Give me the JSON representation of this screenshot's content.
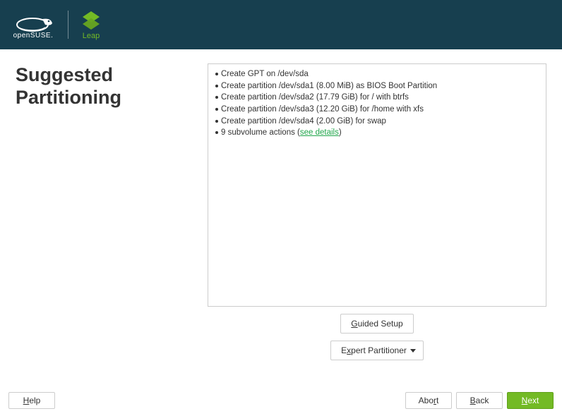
{
  "header": {
    "suse_text": "openSUSE.",
    "leap_text": "Leap"
  },
  "page": {
    "title": "Suggested Partitioning"
  },
  "actions": {
    "items": [
      {
        "text": "Create GPT on /dev/sda"
      },
      {
        "text": "Create partition /dev/sda1 (8.00 MiB) as BIOS Boot Partition"
      },
      {
        "text": "Create partition /dev/sda2 (17.79 GiB) for / with btrfs"
      },
      {
        "text": "Create partition /dev/sda3 (12.20 GiB) for /home with xfs"
      },
      {
        "text": "Create partition /dev/sda4 (2.00 GiB) for swap"
      }
    ],
    "subvolume_prefix": "9 subvolume actions (",
    "subvolume_link": "see details",
    "subvolume_suffix": ")"
  },
  "buttons": {
    "guided_m": "G",
    "guided_rest": "uided Setup",
    "expert_pre": "E",
    "expert_m": "x",
    "expert_rest": "pert Partitioner",
    "help_m": "H",
    "help_rest": "elp",
    "abort_pre": "Abo",
    "abort_m": "r",
    "abort_rest": "t",
    "back_m": "B",
    "back_rest": "ack",
    "next_m": "N",
    "next_rest": "ext"
  }
}
